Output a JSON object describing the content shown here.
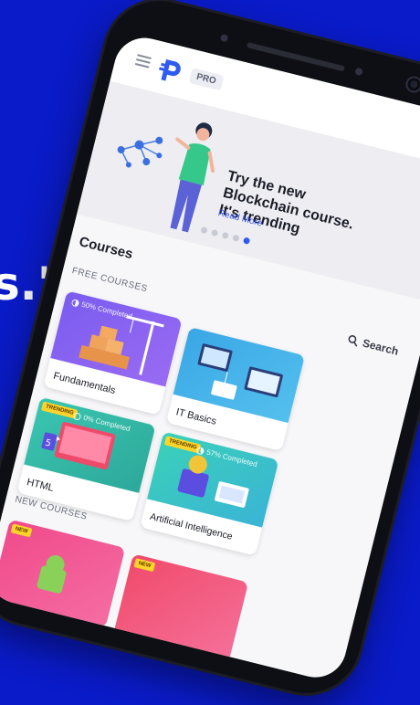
{
  "quote": {
    "fragment": "s.\""
  },
  "topbar": {
    "badge": "PRO"
  },
  "banner": {
    "title": "Try the new Blockchain course. It's trending",
    "link": "Read More",
    "dots_total": 5,
    "dot_active_index": 4
  },
  "courses": {
    "title": "Courses",
    "free_label": "FREE COURSES",
    "search_label": "Search",
    "new_label": "NEW COURSES",
    "free_cards": [
      {
        "title": "Fundamentals",
        "progress": "50% Completed",
        "tag": "",
        "colors": [
          "#7a5cf0",
          "#9a6bf2"
        ]
      },
      {
        "title": "IT Basics",
        "progress": "",
        "tag": "",
        "colors": [
          "#3aa7e6",
          "#54c0ee"
        ]
      },
      {
        "title": "HTML",
        "progress": "0% Completed",
        "tag": "TRENDING",
        "colors": [
          "#3ac6b0",
          "#2da89a"
        ]
      },
      {
        "title": "Artificial Intelligence",
        "progress": "57% Completed",
        "tag": "TRENDING",
        "colors": [
          "#3ad1b8",
          "#3ab4d6"
        ]
      }
    ],
    "new_cards": [
      {
        "tag": "NEW",
        "colors": [
          "#f04a8a",
          "#f56da2"
        ]
      },
      {
        "tag": "NEW",
        "colors": [
          "#f04a6a",
          "#f5709a"
        ]
      }
    ]
  },
  "colors": {
    "background": "#0a1bc9",
    "accent": "#2f5bf0"
  }
}
